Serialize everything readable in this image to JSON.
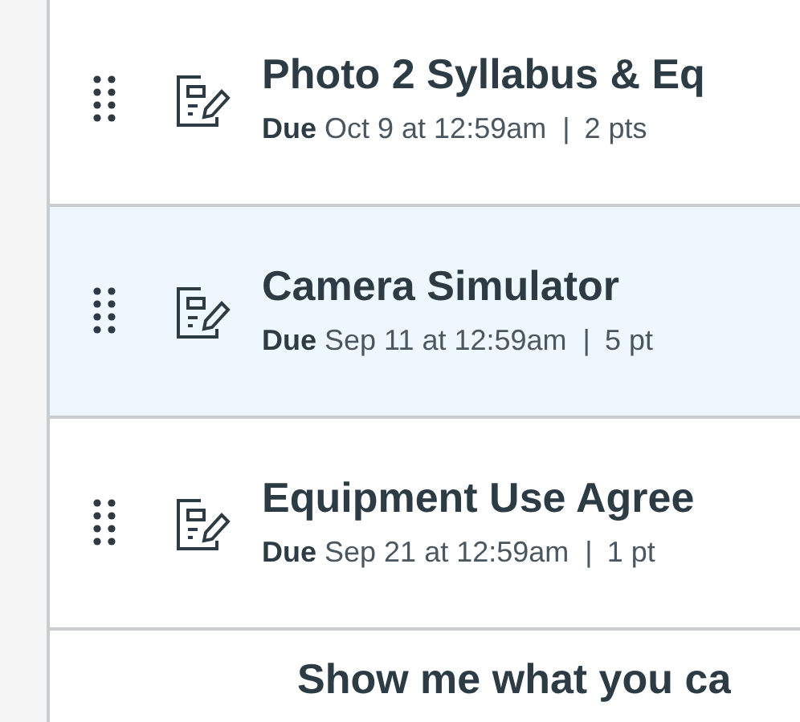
{
  "assignments": [
    {
      "title": "Photo 2 Syllabus & Eq",
      "due_label": "Due",
      "due_date": "Oct 9 at 12:59am",
      "separator": "|",
      "points": "2 pts",
      "selected": false
    },
    {
      "title": "Camera Simulator",
      "due_label": "Due",
      "due_date": "Sep 11 at 12:59am",
      "separator": "|",
      "points": "5 pt",
      "selected": true
    },
    {
      "title": "Equipment Use Agree",
      "due_label": "Due",
      "due_date": "Sep 21 at 12:59am",
      "separator": "|",
      "points": "1 pt",
      "selected": false
    },
    {
      "title": "Show me what you ca",
      "selected": false
    }
  ]
}
